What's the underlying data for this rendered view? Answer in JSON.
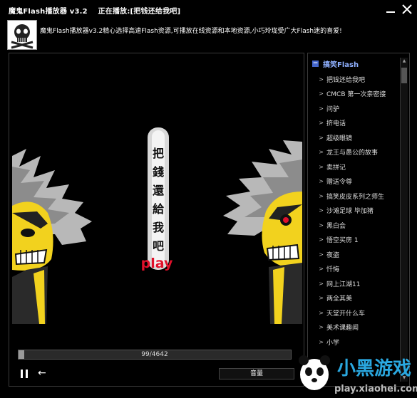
{
  "window": {
    "app_title": "魔鬼Flash播放器 v3.2",
    "now_playing": "正在播放:[把钱还给我吧]"
  },
  "header": {
    "intro": "魔鬼Flash播放器v3.2精心选择高速Flash资源,可播放在线资源和本地资源,小巧玲珑受广大Flash迷的喜爱!"
  },
  "stage": {
    "banner_text": "把錢還給我吧",
    "play_label": "play"
  },
  "controls": {
    "progress_text": "99/4642",
    "progress_value": 99,
    "progress_total": 4642,
    "back_symbol": "←",
    "volume_label": "音量"
  },
  "playlist": {
    "category": "搞笑Flash",
    "collapse_symbol": "−",
    "items": [
      "把钱还给我吧",
      "CMCB 第一次亲密接",
      "问驴",
      "挤电话",
      "超级眼镜",
      "龙王与愚公的故事",
      "卖拼记",
      "赠送令尊",
      "搞笑皮皮系列之师生",
      "沙滩足球 毕加猪",
      "黑白会",
      "悟空买房 1",
      "夜盗",
      "忏悔",
      "网上江湖11",
      "两全其美",
      "天堂开什么车",
      "美术课趣闻",
      "小学"
    ]
  },
  "watermark": {
    "brand": "小黑游戏",
    "url": "play.xiaohei.com"
  },
  "colors": {
    "background": "#000000",
    "category_text": "#8fb0ff",
    "play_red": "#e0102a",
    "face_yellow": "#f2d21e"
  }
}
